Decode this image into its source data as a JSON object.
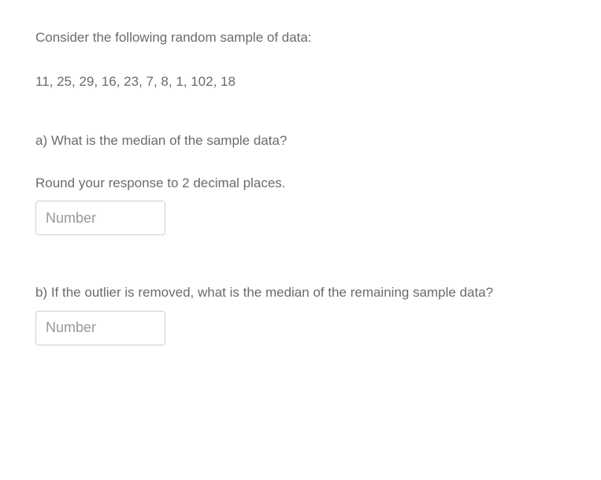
{
  "intro": "Consider the following random sample of data:",
  "data_values": "11, 25, 29, 16, 23, 7, 8, 1, 102, 18",
  "question_a": "a)  What is the median of the sample data?",
  "instruction_a": "Round your response to 2 decimal places.",
  "input_a": {
    "placeholder": "Number",
    "value": ""
  },
  "question_b": "b)  If the outlier is removed, what is the median of the remaining sample data?",
  "input_b": {
    "placeholder": "Number",
    "value": ""
  }
}
